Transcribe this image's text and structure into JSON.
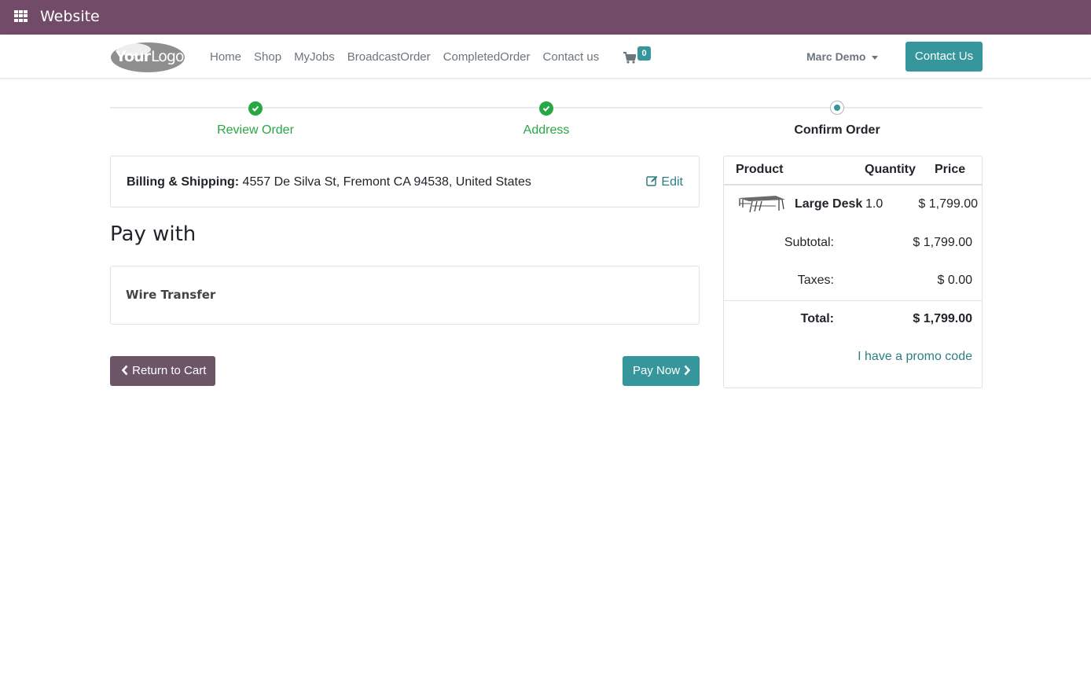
{
  "topbar": {
    "title": "Website",
    "bg_color": "#714b67"
  },
  "navbar": {
    "logo_text": "YourLogo",
    "links": [
      "Home",
      "Shop",
      "MyJobs",
      "BroadcastOrder",
      "CompletedOrder",
      "Contact us"
    ],
    "cart_count": "0",
    "user_name": "Marc Demo",
    "contact_label": "Contact Us",
    "accent_color": "#35979c"
  },
  "steps": [
    {
      "label": "Review Order",
      "state": "done"
    },
    {
      "label": "Address",
      "state": "done"
    },
    {
      "label": "Confirm Order",
      "state": "current"
    }
  ],
  "billing": {
    "label": "Billing & Shipping:",
    "address": "4557 De Silva St, Fremont CA 94538, United States",
    "edit_label": "Edit"
  },
  "payment": {
    "heading": "Pay with",
    "method": "Wire Transfer"
  },
  "actions": {
    "return_label": "Return to Cart",
    "pay_label": "Pay Now"
  },
  "summary": {
    "headers": {
      "product": "Product",
      "quantity": "Quantity",
      "price": "Price"
    },
    "item": {
      "name": "Large Desk",
      "quantity": "1.0",
      "price": "$ 1,799.00"
    },
    "subtotal_label": "Subtotal:",
    "subtotal_value": "$ 1,799.00",
    "taxes_label": "Taxes:",
    "taxes_value": "$ 0.00",
    "total_label": "Total:",
    "total_value": "$ 1,799.00",
    "promo_label": "I have a promo code"
  }
}
